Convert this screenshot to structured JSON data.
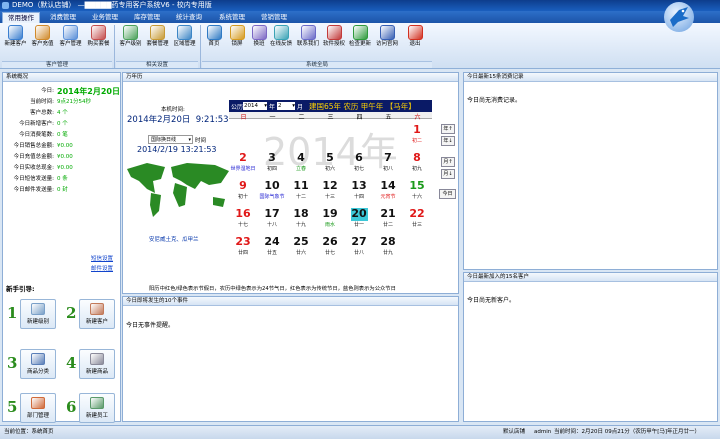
{
  "window": {
    "title": "DEMO（默认店铺） —▇▇▇▇▇药专用客户系统V6 - 校内专用版"
  },
  "tabs": [
    {
      "label": "常用操作",
      "active": true
    },
    {
      "label": "消费管理"
    },
    {
      "label": "业务管理"
    },
    {
      "label": "库存管理"
    },
    {
      "label": "统计查询"
    },
    {
      "label": "系统管理"
    },
    {
      "label": "营销管理"
    }
  ],
  "toolbar": {
    "buttons": [
      {
        "label": "新建客户",
        "icon": "new-customer-icon",
        "color": "#3b7fd0"
      },
      {
        "label": "客户充值",
        "icon": "recharge-icon",
        "color": "#d08a2b"
      },
      {
        "label": "客户管理",
        "icon": "customer-manage-icon",
        "color": "#5a8fd8"
      },
      {
        "label": "购买套餐",
        "icon": "buy-package-icon",
        "color": "#c44d4d"
      },
      {
        "label": "客户级别",
        "icon": "customer-level-icon",
        "color": "#4aa05a"
      },
      {
        "label": "套餐管理",
        "icon": "package-manage-icon",
        "color": "#c79a35"
      },
      {
        "label": "区域管理",
        "icon": "region-manage-icon",
        "color": "#3d86c6"
      },
      {
        "label": "首页",
        "icon": "home-icon",
        "color": "#2f7ac4"
      },
      {
        "label": "锁屏",
        "icon": "lock-icon",
        "color": "#d59b20"
      },
      {
        "label": "换班",
        "icon": "shift-icon",
        "color": "#7b67c4"
      },
      {
        "label": "在线反馈",
        "icon": "feedback-icon",
        "color": "#3aa3b6"
      },
      {
        "label": "联系我们",
        "icon": "contact-icon",
        "color": "#6a6ac8"
      },
      {
        "label": "软件授权",
        "icon": "license-icon",
        "color": "#c23a3a"
      },
      {
        "label": "检查更新",
        "icon": "update-icon",
        "color": "#2e9a3c"
      },
      {
        "label": "访问官网",
        "icon": "website-icon",
        "color": "#365fb4"
      },
      {
        "label": "退出",
        "icon": "exit-icon",
        "color": "#d23020"
      }
    ],
    "groups": [
      "客户管理",
      "相关设置",
      "系统全局"
    ]
  },
  "overview": {
    "header": "系统概况",
    "rows": [
      {
        "k": "今日:",
        "v": "2014年2月20日",
        "big": true
      },
      {
        "k": "当前时间:",
        "v": "9点21分54秒"
      },
      {
        "k": "客户总数:",
        "v": "4 个"
      },
      {
        "k": "今日新增客户:",
        "v": "0 个"
      },
      {
        "k": "今日消费笔数:",
        "v": "0 笔"
      },
      {
        "k": "今日销售总金额:",
        "v": "¥0.00"
      },
      {
        "k": "今日充值总金额:",
        "v": "¥0.00"
      },
      {
        "k": "今日实收总现金:",
        "v": "¥0.00"
      },
      {
        "k": "今日短信发送量:",
        "v": "0 条"
      },
      {
        "k": "今日邮件发送量:",
        "v": "0 封"
      }
    ],
    "sms_link": "短信设置",
    "mail_link": "邮件设置"
  },
  "guide": {
    "header": "新手引导:",
    "steps": [
      {
        "n": "1",
        "label": "新建级别",
        "color": "#7aa0c8"
      },
      {
        "n": "2",
        "label": "新建客户",
        "color": "#c27a5a"
      },
      {
        "n": "3",
        "label": "商品分类",
        "color": "#5a7fb8"
      },
      {
        "n": "4",
        "label": "新建商品",
        "color": "#8a8a9a"
      },
      {
        "n": "5",
        "label": "部门管理",
        "color": "#d06a3a"
      },
      {
        "n": "6",
        "label": "新建员工",
        "color": "#5a9a6a"
      }
    ]
  },
  "calendar": {
    "panel_title": "万年历",
    "local_time_label": "本机时间:",
    "local_date": "2014年2月20日",
    "local_time": "9:21:53",
    "gmt_select": "国际换日线",
    "gmt_time_label": "时间",
    "gmt_datetime": "2014/2/19 13:21:53",
    "city": "安尼威土克、瓜甲兰",
    "ad_label": "公历",
    "year": "2014",
    "year_unit": "年",
    "month": "2",
    "month_unit": "月",
    "lunar_header": "建国65年 农历 甲午年 【马年】",
    "big_year": "2014年",
    "weekdays": [
      "日",
      "一",
      "二",
      "三",
      "四",
      "五",
      "六"
    ],
    "cells": [
      {
        "d": "1",
        "s": "初二",
        "c": "red",
        "sc": "red"
      },
      {
        "d": "2",
        "s": "世界湿地日",
        "c": "red",
        "sc": "blue"
      },
      {
        "d": "3",
        "s": "初四",
        "c": "black"
      },
      {
        "d": "4",
        "s": "立春",
        "c": "black",
        "sc": "green"
      },
      {
        "d": "5",
        "s": "初六",
        "c": "black"
      },
      {
        "d": "6",
        "s": "初七",
        "c": "black"
      },
      {
        "d": "7",
        "s": "初八",
        "c": "black"
      },
      {
        "d": "8",
        "s": "初九",
        "c": "red"
      },
      {
        "d": "9",
        "s": "初十",
        "c": "red"
      },
      {
        "d": "10",
        "s": "国际气象节",
        "c": "black",
        "sc": "blue"
      },
      {
        "d": "11",
        "s": "十二",
        "c": "black"
      },
      {
        "d": "12",
        "s": "十三",
        "c": "black"
      },
      {
        "d": "13",
        "s": "十四",
        "c": "black"
      },
      {
        "d": "14",
        "s": "元宵节",
        "c": "black",
        "sc": "red"
      },
      {
        "d": "15",
        "s": "十六",
        "c": "green"
      },
      {
        "d": "16",
        "s": "十七",
        "c": "red"
      },
      {
        "d": "17",
        "s": "十八",
        "c": "black"
      },
      {
        "d": "18",
        "s": "十九",
        "c": "black"
      },
      {
        "d": "19",
        "s": "雨水",
        "c": "black",
        "sc": "green"
      },
      {
        "d": "20",
        "s": "廿一",
        "c": "black",
        "today": true
      },
      {
        "d": "21",
        "s": "廿二",
        "c": "black"
      },
      {
        "d": "22",
        "s": "廿三",
        "c": "red"
      },
      {
        "d": "23",
        "s": "廿四",
        "c": "red"
      },
      {
        "d": "24",
        "s": "廿五",
        "c": "black"
      },
      {
        "d": "25",
        "s": "廿六",
        "c": "black"
      },
      {
        "d": "26",
        "s": "廿七",
        "c": "black"
      },
      {
        "d": "27",
        "s": "廿八",
        "c": "black"
      },
      {
        "d": "28",
        "s": "廿九",
        "c": "black"
      }
    ],
    "side_buttons": [
      "年↑",
      "年↓",
      "月↑",
      "月↓",
      "今日"
    ],
    "legend": "阳历中红色/绿色表示节假日，农历中绿色表示为24节气日，红色表示为传统节日，蓝色则表示为公众节日"
  },
  "events": {
    "header": "今日即将发生的10个事件",
    "empty": "今日无事件提醒。"
  },
  "consume": {
    "header": "今日最新15条消费记录",
    "empty": "今日尚无消费记录。"
  },
  "newcust": {
    "header": "今日最新加入的15名客户",
    "empty": "今日尚无新客户。"
  },
  "status": {
    "position": "当前位置：系统首页",
    "shop": "默认店铺",
    "user": "admin",
    "time": "当前时间：2月20日 09点21分（农历甲午[马]年正月廿一）"
  }
}
